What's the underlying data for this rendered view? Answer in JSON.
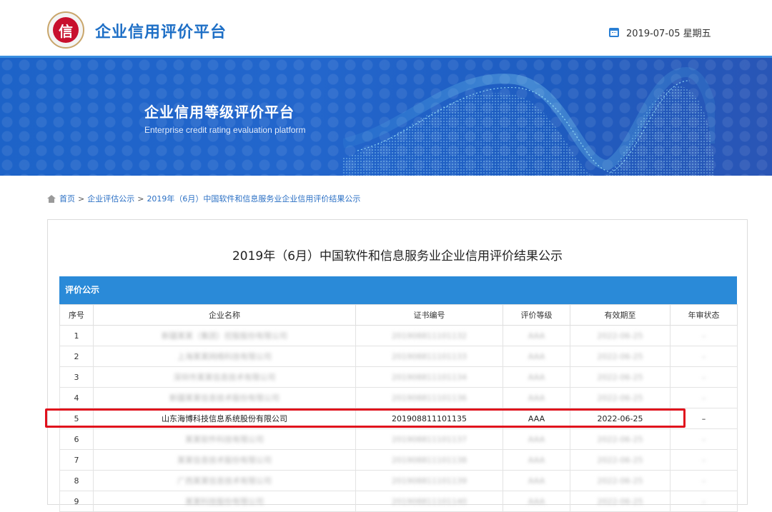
{
  "header": {
    "logo_char": "信",
    "site_title": "企业信用评价平台",
    "date_text": "2019-07-05 星期五"
  },
  "banner": {
    "title": "企业信用等级评价平台",
    "subtitle": "Enterprise credit rating evaluation platform"
  },
  "breadcrumb": {
    "items": [
      "首页",
      "企业评估公示",
      "2019年（6月）中国软件和信息服务业企业信用评价结果公示"
    ],
    "separator": ">"
  },
  "article": {
    "title": "2019年（6月）中国软件和信息服务业企业信用评价结果公示"
  },
  "table": {
    "section_label": "评价公示",
    "columns": [
      "序号",
      "企业名称",
      "证书编号",
      "评价等级",
      "有效期至",
      "年审状态"
    ],
    "rows": [
      {
        "no": "1",
        "name": "新疆某某（集团）控股股份有限公司",
        "cert": "201908811101132",
        "level": "AAA",
        "expiry": "2022-06-25",
        "status": "–",
        "blurred": true
      },
      {
        "no": "2",
        "name": "上海某某网络科技有限公司",
        "cert": "201908811101133",
        "level": "AAA",
        "expiry": "2022-06-25",
        "status": "–",
        "blurred": true
      },
      {
        "no": "3",
        "name": "深圳市某某信息技术有限公司",
        "cert": "201908811101134",
        "level": "AAA",
        "expiry": "2022-06-25",
        "status": "–",
        "blurred": true
      },
      {
        "no": "4",
        "name": "新疆某某信息技术股份有限公司",
        "cert": "201908811101136",
        "level": "AAA",
        "expiry": "2022-06-25",
        "status": "–",
        "blurred": true
      },
      {
        "no": "5",
        "name": "山东海博科技信息系统股份有限公司",
        "cert": "201908811101135",
        "level": "AAA",
        "expiry": "2022-06-25",
        "status": "–",
        "blurred": false
      },
      {
        "no": "6",
        "name": "某某软件科技有限公司",
        "cert": "201908811101137",
        "level": "AAA",
        "expiry": "2022-06-25",
        "status": "–",
        "blurred": true
      },
      {
        "no": "7",
        "name": "某某信息技术股份有限公司",
        "cert": "201908811101138",
        "level": "AAA",
        "expiry": "2022-06-25",
        "status": "–",
        "blurred": true
      },
      {
        "no": "8",
        "name": "广西某某信息技术有限公司",
        "cert": "201908811101139",
        "level": "AAA",
        "expiry": "2022-06-25",
        "status": "–",
        "blurred": true
      },
      {
        "no": "9",
        "name": "某某科技股份有限公司",
        "cert": "201908811101140",
        "level": "AAA",
        "expiry": "2022-06-25",
        "status": "–",
        "blurred": true
      }
    ]
  },
  "colors": {
    "brand_blue": "#1e6fc6",
    "table_header_blue": "#2a8ad8",
    "highlight_red": "#e0101c"
  }
}
